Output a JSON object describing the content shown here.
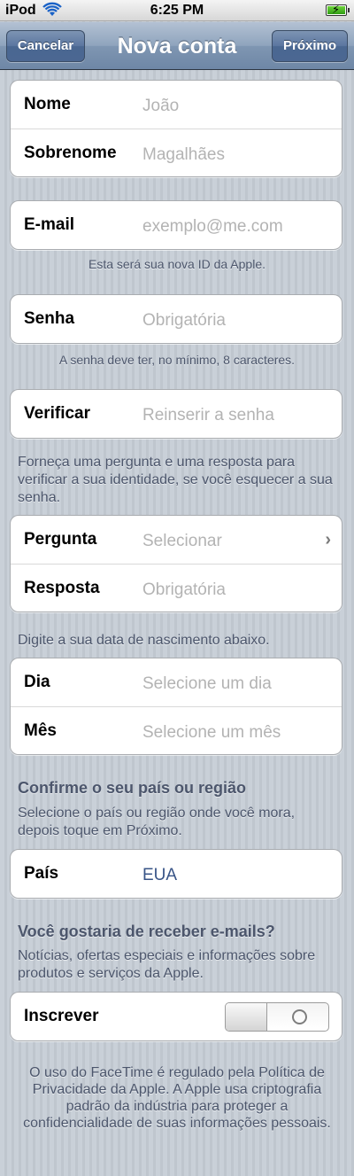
{
  "status_bar": {
    "carrier": "iPod",
    "time": "6:25 PM",
    "wifi_icon": "wifi-icon",
    "battery_icon": "battery-charging-icon"
  },
  "nav": {
    "cancel": "Cancelar",
    "title": "Nova conta",
    "next": "Próximo"
  },
  "name_group": {
    "first_label": "Nome",
    "first_placeholder": "João",
    "last_label": "Sobrenome",
    "last_placeholder": "Magalhães"
  },
  "email": {
    "label": "E-mail",
    "placeholder": "exemplo@me.com",
    "note": "Esta será sua nova ID da Apple."
  },
  "password": {
    "label": "Senha",
    "placeholder": "Obrigatória",
    "note": "A senha deve ter, no mínimo, 8 caracteres."
  },
  "verify": {
    "label": "Verificar",
    "placeholder": "Reinserir a senha"
  },
  "security": {
    "intro": "Forneça uma pergunta e uma resposta para verificar a sua identidade, se você esquecer a sua senha.",
    "question_label": "Pergunta",
    "question_value": "Selecionar",
    "answer_label": "Resposta",
    "answer_placeholder": "Obrigatória"
  },
  "birth": {
    "intro": "Digite a sua data de nascimento abaixo.",
    "day_label": "Dia",
    "day_value": "Selecione um dia",
    "month_label": "Mês",
    "month_value": "Selecione um mês"
  },
  "country": {
    "heading": "Confirme o seu país ou região",
    "intro": "Selecione o país ou região onde você mora, depois toque em Próximo.",
    "label": "País",
    "value": "EUA"
  },
  "emails_opt": {
    "heading": "Você gostaria de receber e-mails?",
    "intro": "Notícias, ofertas especiais e informações sobre produtos e serviços da Apple.",
    "label": "Inscrever",
    "toggle_state": "off"
  },
  "footer": "O uso do FaceTime é regulado pela Política de Privacidade da Apple. A Apple usa criptografia padrão da indústria para proteger a confidencialidade de suas informações pessoais.",
  "colors": {
    "navbar": "#7f96b2",
    "background": "#c5ccd4",
    "value_blue": "#385487",
    "placeholder": "#b3b3b3"
  }
}
